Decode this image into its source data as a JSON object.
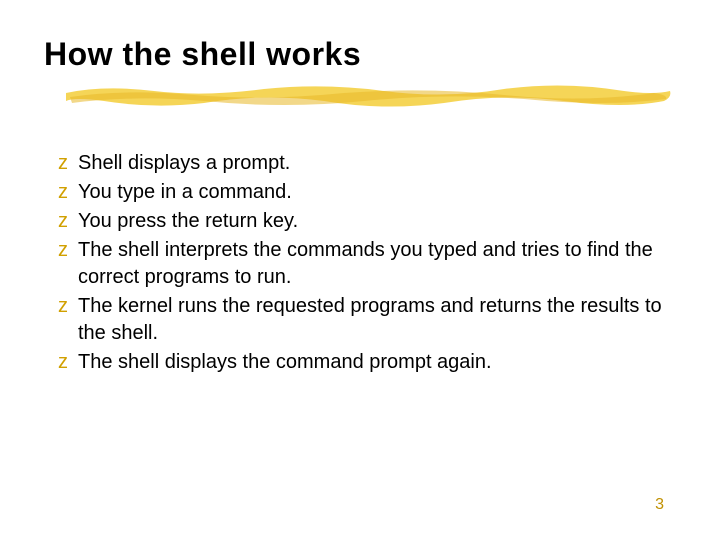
{
  "title": "How the shell works",
  "bullets": [
    {
      "text": "Shell displays a prompt."
    },
    {
      "text": "You type in a command."
    },
    {
      "text": "You press the return key."
    },
    {
      "text": "The shell interprets the commands you typed and tries to find the correct programs to run."
    },
    {
      "text": "The kernel runs the requested programs and returns the results to the shell."
    },
    {
      "text": "The shell displays the command prompt again."
    }
  ],
  "bullet_marker": "z",
  "page_number": "3",
  "colors": {
    "accent": "#d1a000",
    "page_num": "#c09000"
  }
}
